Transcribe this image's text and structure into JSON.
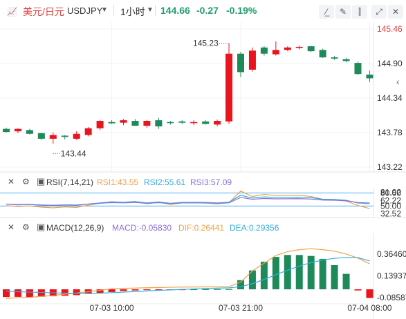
{
  "header": {
    "symbol_name": "美元/日元",
    "symbol_code": "USDJPY",
    "period": "1小时",
    "price": "144.66",
    "change": "-0.27",
    "change_pct": "-0.19%",
    "icons": [
      "line-tool-icon",
      "draw-pen-icon",
      "candle-style-icon",
      "expand-icon",
      "close-icon"
    ]
  },
  "colors": {
    "up": "#e8151e",
    "down": "#1e8a5a",
    "accent_red": "#e04040"
  },
  "chart_data": [
    {
      "type": "candlestick",
      "y_ticks": [
        "145.46",
        "144.90",
        "144.34",
        "143.78",
        "143.22"
      ],
      "ylim": [
        143.22,
        145.46
      ],
      "annotations": {
        "high": "145.23",
        "low": "143.44"
      },
      "candles": [
        {
          "o": 143.84,
          "h": 143.86,
          "l": 143.78,
          "c": 143.79
        },
        {
          "o": 143.8,
          "h": 143.85,
          "l": 143.77,
          "c": 143.84
        },
        {
          "o": 143.82,
          "h": 143.84,
          "l": 143.75,
          "c": 143.76
        },
        {
          "o": 143.77,
          "h": 143.78,
          "l": 143.66,
          "c": 143.68
        },
        {
          "o": 143.68,
          "h": 143.78,
          "l": 143.6,
          "c": 143.74
        },
        {
          "o": 143.73,
          "h": 143.74,
          "l": 143.67,
          "c": 143.71
        },
        {
          "o": 143.68,
          "h": 143.8,
          "l": 143.66,
          "c": 143.76
        },
        {
          "o": 143.74,
          "h": 143.87,
          "l": 143.72,
          "c": 143.85
        },
        {
          "o": 143.85,
          "h": 143.98,
          "l": 143.82,
          "c": 143.97
        },
        {
          "o": 143.95,
          "h": 143.98,
          "l": 143.92,
          "c": 143.93
        },
        {
          "o": 143.94,
          "h": 144.0,
          "l": 143.9,
          "c": 143.98
        },
        {
          "o": 143.97,
          "h": 144.0,
          "l": 143.89,
          "c": 143.89
        },
        {
          "o": 143.89,
          "h": 143.98,
          "l": 143.86,
          "c": 143.97
        },
        {
          "o": 143.98,
          "h": 144.02,
          "l": 143.84,
          "c": 143.88
        },
        {
          "o": 143.95,
          "h": 143.97,
          "l": 143.91,
          "c": 143.94
        },
        {
          "o": 143.96,
          "h": 143.98,
          "l": 143.92,
          "c": 143.94
        },
        {
          "o": 143.94,
          "h": 143.98,
          "l": 143.9,
          "c": 143.95
        },
        {
          "o": 143.96,
          "h": 143.98,
          "l": 143.91,
          "c": 143.92
        },
        {
          "o": 143.91,
          "h": 143.99,
          "l": 143.88,
          "c": 143.97
        },
        {
          "o": 143.96,
          "h": 145.23,
          "l": 143.92,
          "c": 145.06
        },
        {
          "o": 145.06,
          "h": 145.09,
          "l": 144.68,
          "c": 144.76
        },
        {
          "o": 144.8,
          "h": 145.16,
          "l": 144.77,
          "c": 145.11
        },
        {
          "o": 145.16,
          "h": 145.18,
          "l": 145.03,
          "c": 145.06
        },
        {
          "o": 145.05,
          "h": 145.26,
          "l": 145.03,
          "c": 145.12
        },
        {
          "o": 145.12,
          "h": 145.18,
          "l": 145.1,
          "c": 145.16
        },
        {
          "o": 145.16,
          "h": 145.19,
          "l": 145.13,
          "c": 145.17
        },
        {
          "o": 145.18,
          "h": 145.19,
          "l": 145.09,
          "c": 145.1
        },
        {
          "o": 145.12,
          "h": 145.14,
          "l": 144.99,
          "c": 145.0
        },
        {
          "o": 145.0,
          "h": 145.02,
          "l": 144.96,
          "c": 144.98
        },
        {
          "o": 144.97,
          "h": 144.99,
          "l": 144.92,
          "c": 144.94
        },
        {
          "o": 144.91,
          "h": 144.93,
          "l": 144.71,
          "c": 144.73
        },
        {
          "o": 144.72,
          "h": 144.78,
          "l": 144.6,
          "c": 144.66
        }
      ],
      "x_labels": [
        {
          "label": "07-03 10:00",
          "index": 9
        },
        {
          "label": "07-03 21:00",
          "index": 20
        },
        {
          "label": "07-04 08:00",
          "index": 31
        }
      ]
    },
    {
      "type": "line",
      "name": "RSI",
      "header": "RSI(7,14,21)",
      "legend": [
        {
          "text": "RSI1:43.55",
          "color": "#f0a04b"
        },
        {
          "text": "RSI2:55.61",
          "color": "#33aedc"
        },
        {
          "text": "RSI3:57.09",
          "color": "#8b6fd6"
        }
      ],
      "y_ticks": [
        "81.92",
        "80.00",
        "62.22",
        "50.00",
        "32.52"
      ],
      "ylim": [
        22,
        92
      ],
      "reference_lines": [
        80,
        50
      ],
      "series": [
        {
          "name": "RSI1",
          "color": "#f0a04b",
          "values": [
            50.7,
            49.1,
            50.2,
            47.4,
            45.9,
            48.0,
            46.9,
            52.0,
            56.3,
            60.1,
            58.3,
            60.7,
            55.2,
            59.0,
            53.3,
            57.1,
            57.4,
            56.8,
            55.0,
            57.8,
            84.4,
            71.9,
            77.0,
            74.2,
            74.4,
            74.8,
            72.0,
            65.6,
            64.6,
            61.4,
            51.4,
            44.2
          ]
        },
        {
          "name": "RSI2",
          "color": "#33aedc",
          "values": [
            54.1,
            53.0,
            53.5,
            51.8,
            50.8,
            52.1,
            51.5,
            54.6,
            57.2,
            59.6,
            58.6,
            60.2,
            57.2,
            59.4,
            56.4,
            58.4,
            58.6,
            58.4,
            57.3,
            58.9,
            74.8,
            68.4,
            71.1,
            69.8,
            70.2,
            70.4,
            69.2,
            65.7,
            65.1,
            63.3,
            57.0,
            55.6
          ]
        },
        {
          "name": "RSI3",
          "color": "#8b6fd6",
          "values": [
            54.3,
            53.4,
            53.7,
            52.5,
            51.8,
            52.7,
            52.4,
            54.5,
            56.4,
            57.9,
            57.3,
            58.3,
            56.2,
            57.8,
            55.7,
            57.1,
            57.3,
            57.1,
            56.3,
            57.4,
            69.8,
            65.6,
            67.4,
            66.5,
            66.8,
            66.9,
            66.1,
            63.8,
            63.4,
            62.2,
            58.0,
            57.1
          ]
        }
      ]
    },
    {
      "type": "bar+line",
      "name": "MACD",
      "header": "MACD(12,26,9)",
      "legend": [
        {
          "text": "MACD:-0.05830",
          "color": "#8b6fd6"
        },
        {
          "text": "DIF:0.26441",
          "color": "#f0a04b"
        },
        {
          "text": "DEA:0.29356",
          "color": "#33aedc"
        }
      ],
      "y_ticks": [
        "0.36460",
        "0.13937",
        "-0.08587"
      ],
      "ylim": [
        -0.15,
        0.55
      ],
      "histogram": [
        -0.08,
        -0.078,
        -0.08,
        -0.077,
        -0.072,
        -0.067,
        -0.06,
        -0.048,
        -0.038,
        -0.028,
        -0.018,
        -0.012,
        -0.008,
        -0.004,
        -0.002,
        -0.001,
        0.001,
        0.002,
        0.002,
        0.003,
        0.095,
        0.195,
        0.285,
        0.335,
        0.355,
        0.355,
        0.345,
        0.315,
        0.25,
        0.16,
        -0.012,
        -0.09
      ],
      "dif": [
        -0.095,
        -0.087,
        -0.083,
        -0.073,
        -0.063,
        -0.05,
        -0.038,
        -0.025,
        -0.01,
        0.005,
        0.01,
        0.013,
        0.016,
        0.019,
        0.021,
        0.023,
        0.024,
        0.025,
        0.025,
        0.028,
        0.075,
        0.19,
        0.27,
        0.35,
        0.39,
        0.41,
        0.42,
        0.41,
        0.395,
        0.365,
        0.323,
        0.264
      ],
      "dea": [
        -0.02,
        -0.025,
        -0.029,
        -0.032,
        -0.036,
        -0.039,
        -0.042,
        -0.042,
        -0.04,
        -0.035,
        -0.029,
        -0.023,
        -0.017,
        -0.011,
        -0.006,
        -0.001,
        0.004,
        0.008,
        0.012,
        0.015,
        0.027,
        0.059,
        0.101,
        0.151,
        0.197,
        0.24,
        0.276,
        0.303,
        0.321,
        0.33,
        0.328,
        0.294
      ],
      "x_labels": [
        {
          "label": "07-03 10:00",
          "index": 9
        },
        {
          "label": "07-03 21:00",
          "index": 20
        },
        {
          "label": "07-04 08:00",
          "index": 31
        }
      ]
    }
  ]
}
